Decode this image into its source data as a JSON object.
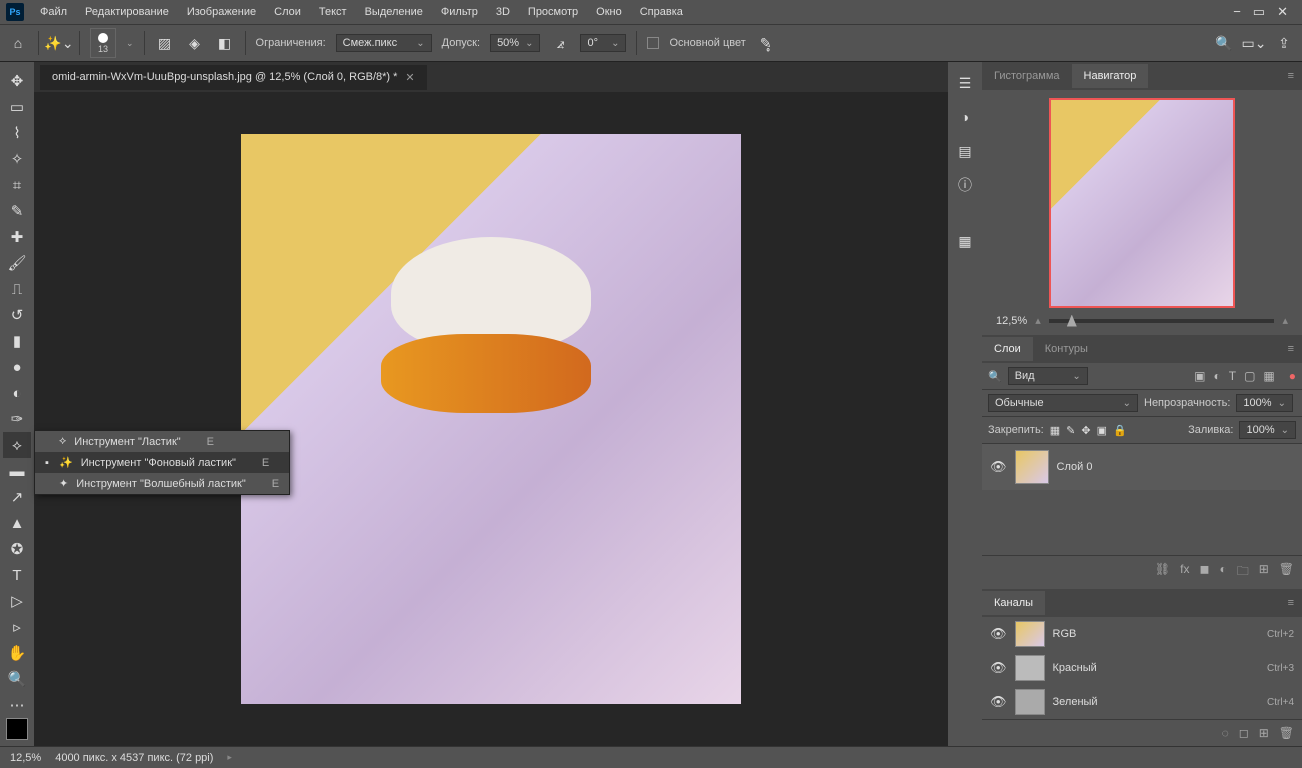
{
  "menu": {
    "items": [
      "Файл",
      "Редактирование",
      "Изображение",
      "Слои",
      "Текст",
      "Выделение",
      "Фильтр",
      "3D",
      "Просмотр",
      "Окно",
      "Справка"
    ]
  },
  "options": {
    "brush_size": "13",
    "limits_label": "Ограничения:",
    "limits_value": "Смеж.пикс",
    "tol_label": "Допуск:",
    "tol_value": "50%",
    "angle_label": "",
    "angle_value": "0°",
    "main_color_label": "Основной цвет"
  },
  "doc": {
    "tab_title": "omid-armin-WxVm-UuuBpg-unsplash.jpg @ 12,5% (Слой 0, RGB/8*) *"
  },
  "flyout": {
    "items": [
      {
        "label": "Инструмент \"Ластик\"",
        "key": "E",
        "selected": false
      },
      {
        "label": "Инструмент \"Фоновый ластик\"",
        "key": "E",
        "selected": true
      },
      {
        "label": "Инструмент \"Волшебный ластик\"",
        "key": "E",
        "selected": false
      }
    ]
  },
  "panels": {
    "histogram_tab": "Гистограмма",
    "navigator_tab": "Навигатор",
    "nav_zoom": "12,5%",
    "layers_tab": "Слои",
    "paths_tab": "Контуры",
    "layer_kind": "Вид",
    "blend_mode": "Обычные",
    "opacity_label": "Непрозрачность:",
    "opacity_val": "100%",
    "lock_label": "Закрепить:",
    "fill_label": "Заливка:",
    "fill_val": "100%",
    "layer0_name": "Слой 0",
    "channels_tab": "Каналы",
    "channels": [
      {
        "name": "RGB",
        "shortcut": "Ctrl+2"
      },
      {
        "name": "Красный",
        "shortcut": "Ctrl+3"
      },
      {
        "name": "Зеленый",
        "shortcut": "Ctrl+4"
      }
    ]
  },
  "status": {
    "zoom": "12,5%",
    "dims": "4000 пикс. x 4537 пикс. (72 ppi)"
  }
}
